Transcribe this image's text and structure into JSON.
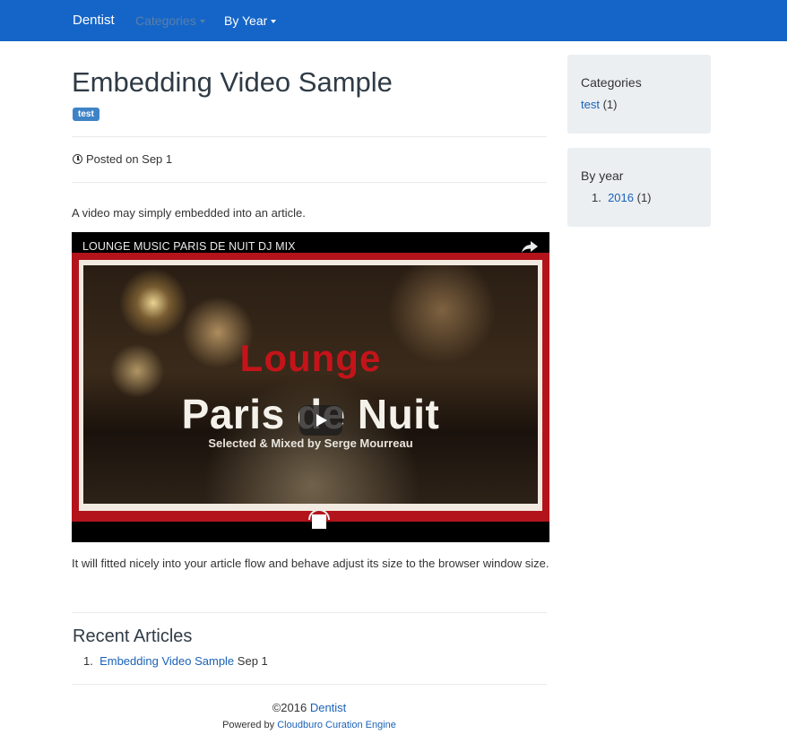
{
  "navbar": {
    "brand": "Dentist",
    "categories_label": "Categories",
    "by_year_label": "By Year",
    "bg_color": "#1565c8"
  },
  "article": {
    "title": "Embedding Video Sample",
    "tag": "test",
    "posted": "Posted on Sep 1",
    "intro": "A video may simply embedded into an article.",
    "after": "It will fitted nicely into your article flow and behave adjust its size to the browser window size."
  },
  "video": {
    "title": "LOUNGE MUSIC PARIS DE NUIT DJ MIX",
    "text_lounge": "Lounge",
    "text_paris": "Paris de Nuit",
    "text_mixed": "Selected & Mixed by Serge Mourreau"
  },
  "recent": {
    "heading": "Recent Articles",
    "items": [
      {
        "num": "1.",
        "title": "Embedding Video Sample",
        "date": "Sep 1"
      }
    ]
  },
  "footer": {
    "copyright": "©2016",
    "brand_link": "Dentist",
    "powered_by": "Powered by",
    "engine_link": "Cloudburo Curation Engine"
  },
  "sidebar": {
    "categories": {
      "heading": "Categories",
      "items": [
        {
          "label": "test",
          "count": "(1)"
        }
      ]
    },
    "by_year": {
      "heading": "By year",
      "items": [
        {
          "num": "1.",
          "label": "2016",
          "count": "(1)"
        }
      ]
    }
  },
  "colors": {
    "link": "#1a62b8",
    "tag": "#3f83c7",
    "well": "#ebeff2"
  }
}
